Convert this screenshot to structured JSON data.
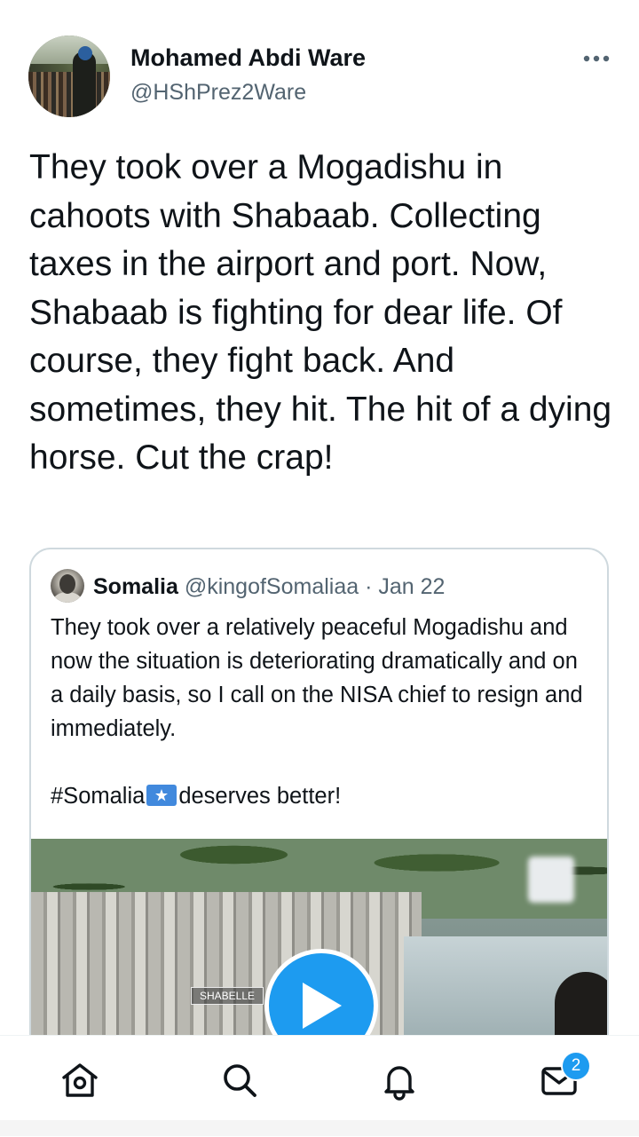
{
  "author": {
    "name": "Mohamed Abdi Ware",
    "handle": "@HShPrez2Ware"
  },
  "tweet": {
    "text": "They took over a Mogadishu in cahoots with Shabaab. Collecting taxes in the airport and port. Now, Shabaab is fighting for dear life. Of course, they fight back. And sometimes, they hit. The hit of a dying horse. Cut the crap!"
  },
  "quoted_tweet": {
    "name": "Somalia",
    "handle": "@kingofSomaliaa",
    "separator": "·",
    "date": "Jan 22",
    "text": "They took over a relatively peaceful Mogadishu and now the situation is deteriorating dramatically and on a daily basis, so I call on the NISA chief to resign and immediately.",
    "hashtag": "#Somalia",
    "hashtag_rest": "deserves better!",
    "video_watermark": "SHABELLE"
  },
  "tabbar": {
    "items": [
      "home-icon",
      "search-icon",
      "notifications-icon",
      "messages-icon"
    ],
    "messages_badge": "2"
  },
  "colors": {
    "accent": "#1d9bf0",
    "text": "#0f1419",
    "secondary": "#536471",
    "border": "#cfd9de"
  }
}
